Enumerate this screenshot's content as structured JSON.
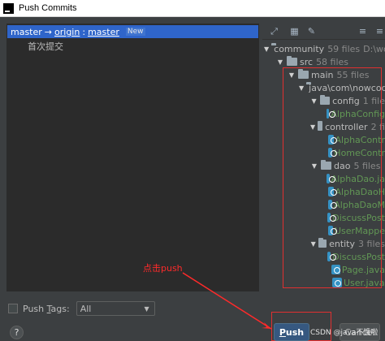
{
  "window": {
    "title": "Push Commits"
  },
  "commit": {
    "branch_local": "master",
    "arrow": "→",
    "remote": "origin",
    "separator": ":",
    "branch_remote": "master",
    "badge": "New",
    "message": "首次提交"
  },
  "toolbar": {
    "icons": [
      "expand-icon",
      "group-icon",
      "edit-icon",
      "expand-all-icon",
      "collapse-all-icon"
    ]
  },
  "tree": {
    "community": {
      "name": "community",
      "count": "59 files",
      "path": "D:\\wor"
    },
    "src": {
      "name": "src",
      "count": "58 files"
    },
    "main": {
      "name": "main",
      "count": "55 files"
    },
    "pkg": {
      "name": "java\\com\\nowcod"
    },
    "config": {
      "name": "config",
      "count": "1 file"
    },
    "config_files": [
      "AlphaConfig"
    ],
    "controller": {
      "name": "controller",
      "count": "2 fi"
    },
    "controller_files": [
      "AlphaContr",
      "HomeContr"
    ],
    "dao": {
      "name": "dao",
      "count": "5 files"
    },
    "dao_files": [
      "AlphaDao.ja",
      "AlphaDaoH",
      "AlphaDaoM",
      "DiscussPost",
      "UserMappe"
    ],
    "entity": {
      "name": "entity",
      "count": "3 files"
    },
    "entity_files": [
      "DiscussPost",
      "Page.java",
      "User.java"
    ]
  },
  "annotation": {
    "text": "点击push",
    "color": "#ff2a2a"
  },
  "bottom": {
    "push_tags_label_prefix": "Push ",
    "push_tags_label_mnemonic": "T",
    "push_tags_label_suffix": "ags:",
    "tags_select_value": "All",
    "help_label": "?",
    "push_button_mnemonic": "P",
    "push_button_rest": "ush",
    "cancel_button": "Cancel",
    "watermark": "CSDN @java不饿啦"
  },
  "colors": {
    "selection": "#2f65ca",
    "modified_file": "#6897bb",
    "added_file": "#629755",
    "highlight_box": "#e03030"
  }
}
